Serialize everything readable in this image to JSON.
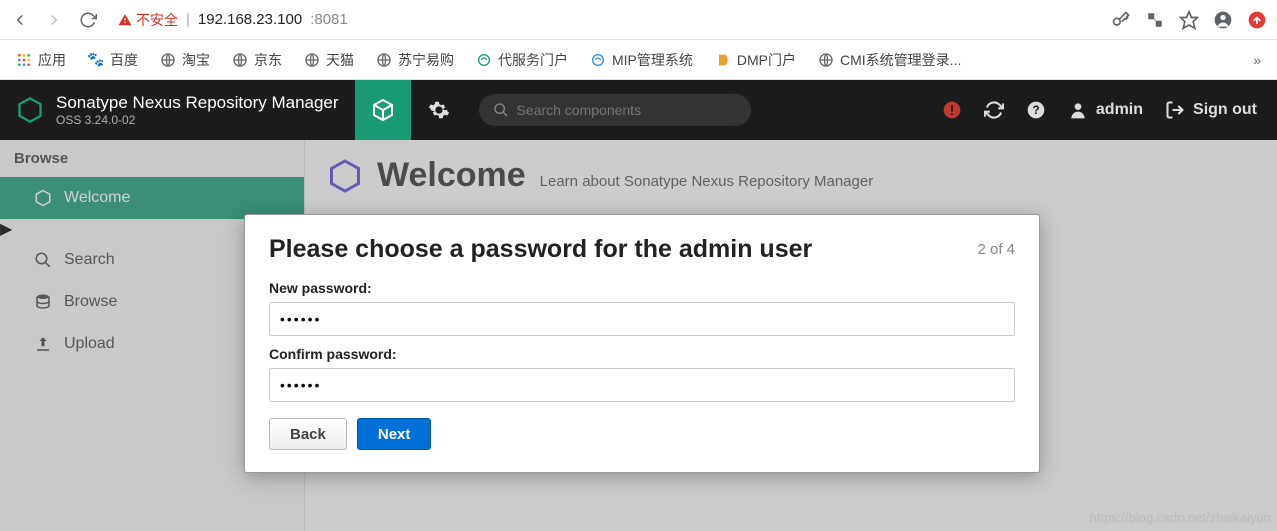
{
  "browser": {
    "insecure_label": "不安全",
    "host": "192.168.23.100",
    "port": ":8081"
  },
  "bookmarks": {
    "apps": "应用",
    "items": [
      {
        "label": "百度"
      },
      {
        "label": "淘宝"
      },
      {
        "label": "京东"
      },
      {
        "label": "天猫"
      },
      {
        "label": "苏宁易购"
      },
      {
        "label": "代服务门户"
      },
      {
        "label": "MIP管理系统"
      },
      {
        "label": "DMP门户"
      },
      {
        "label": "CMI系统管理登录..."
      }
    ]
  },
  "nexus": {
    "title": "Sonatype Nexus Repository Manager",
    "version": "OSS 3.24.0-02",
    "search_placeholder": "Search components",
    "user": "admin",
    "signout": "Sign out"
  },
  "sidebar": {
    "header": "Browse",
    "items": [
      {
        "label": "Welcome"
      },
      {
        "label": "Search"
      },
      {
        "label": "Browse"
      },
      {
        "label": "Upload"
      }
    ]
  },
  "welcome": {
    "title": "Welcome",
    "desc": "Learn about Sonatype Nexus Repository Manager"
  },
  "modal": {
    "title": "Please choose a password for the admin user",
    "step": "2 of 4",
    "new_pw_label": "New password:",
    "confirm_pw_label": "Confirm password:",
    "pw_value": "••••••",
    "back": "Back",
    "next": "Next"
  },
  "watermark": "https://blog.csdn.net/zhaikaiyun"
}
